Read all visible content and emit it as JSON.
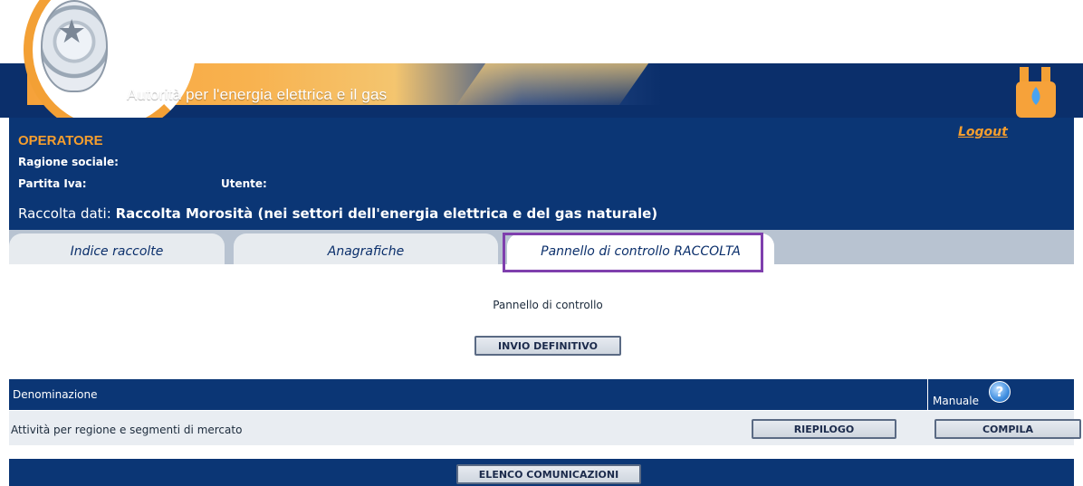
{
  "header": {
    "authority_title": "Autorità per l'energia elettrica e il gas",
    "logout_label": "Logout",
    "emblem_icon": "repubblica-emblem-icon",
    "plug_icon": "gas-plug-icon"
  },
  "operator": {
    "heading": "OPERATORE",
    "ragione_sociale_label": "Ragione sociale:",
    "partita_iva_label": "Partita Iva:",
    "utente_label": "Utente:",
    "raccolta_prefix": "Raccolta dati:",
    "raccolta_name": "Raccolta Morosità (nei settori dell'energia elettrica e del gas naturale)"
  },
  "tabs": [
    {
      "label": "Indice raccolte",
      "active": false
    },
    {
      "label": "Anagrafiche",
      "active": false
    },
    {
      "label": "Pannello di controllo RACCOLTA",
      "active": true
    }
  ],
  "control": {
    "heading": "Pannello di controllo",
    "invio_button": "INVIO DEFINITIVO"
  },
  "table": {
    "columns": {
      "denominazione": "Denominazione",
      "manuale": "Manuale"
    },
    "rows": [
      {
        "label": "Attività per regione e segmenti di mercato",
        "riepilogo": "RIEPILOGO",
        "compila": "COMPILA"
      }
    ]
  },
  "footer": {
    "elenco_button": "ELENCO COMUNICAZIONI"
  },
  "colors": {
    "navy": "#0b3675",
    "orange": "#f59e2e",
    "highlight": "#7f3fad"
  }
}
